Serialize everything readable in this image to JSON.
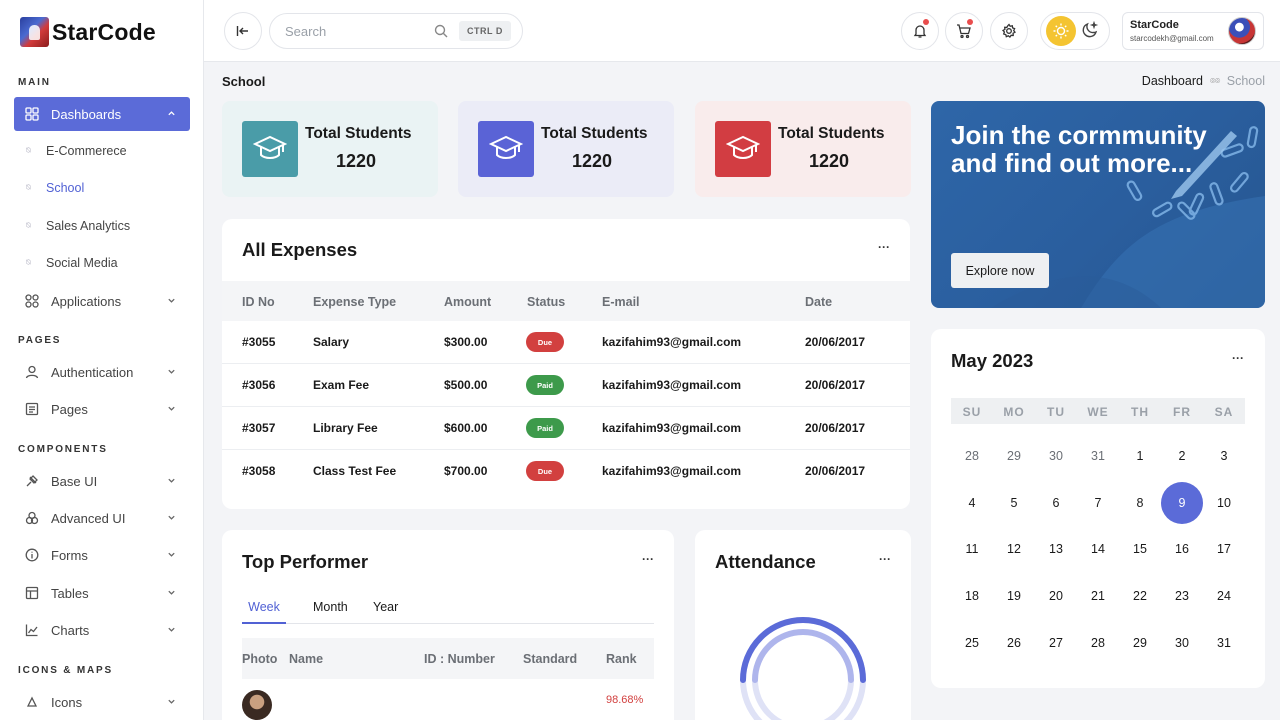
{
  "brand": {
    "name": "StarCode"
  },
  "sidebar": {
    "sections": [
      "MAIN",
      "PAGES",
      "COMPONENTS",
      "ICONS & MAPS"
    ],
    "dashboards": "Dashboards",
    "sub": [
      "E-Commerece",
      "School",
      "Sales Analytics",
      "Social Media"
    ],
    "applications": "Applications",
    "authentication": "Authentication",
    "pages": "Pages",
    "base_ui": "Base UI",
    "advanced_ui": "Advanced UI",
    "forms": "Forms",
    "tables": "Tables",
    "charts": "Charts",
    "icons": "Icons"
  },
  "topbar": {
    "search_placeholder": "Search",
    "shortcut": "CTRL D",
    "user_name": "StarCode",
    "user_email": "starcodekh@gmail.com"
  },
  "page": {
    "title": "School",
    "breadcrumb": [
      "Dashboard",
      "School"
    ]
  },
  "stats": [
    {
      "label": "Total Students",
      "value": "1220",
      "bg": "#eaf3f4",
      "icon_bg": "#4a9ca8"
    },
    {
      "label": "Total Students",
      "value": "1220",
      "bg": "#ebecf7",
      "icon_bg": "#5a63d6"
    },
    {
      "label": "Total Students",
      "value": "1220",
      "bg": "#f9ecec",
      "icon_bg": "#d23d42"
    }
  ],
  "expenses": {
    "title": "All Expenses",
    "columns": [
      "ID No",
      "Expense Type",
      "Amount",
      "Status",
      "E-mail",
      "Date"
    ],
    "rows": [
      {
        "id": "#3055",
        "type": "Salary",
        "amount": "$300.00",
        "status": "Due",
        "email": "kazifahim93@gmail.com",
        "date": "20/06/2017"
      },
      {
        "id": "#3056",
        "type": "Exam Fee",
        "amount": "$500.00",
        "status": "Paid",
        "email": "kazifahim93@gmail.com",
        "date": "20/06/2017"
      },
      {
        "id": "#3057",
        "type": "Library Fee",
        "amount": "$600.00",
        "status": "Paid",
        "email": "kazifahim93@gmail.com",
        "date": "20/06/2017"
      },
      {
        "id": "#3058",
        "type": "Class Test Fee",
        "amount": "$700.00",
        "status": "Due",
        "email": "kazifahim93@gmail.com",
        "date": "20/06/2017"
      }
    ]
  },
  "promo": {
    "title": "Join the cormmunity and find out more...",
    "button": "Explore now"
  },
  "calendar": {
    "title": "May 2023",
    "dow": [
      "SU",
      "MO",
      "TU",
      "WE",
      "TH",
      "FR",
      "SA"
    ],
    "weeks": [
      [
        "28",
        "29",
        "30",
        "31",
        "1",
        "2",
        "3"
      ],
      [
        "4",
        "5",
        "6",
        "7",
        "8",
        "9",
        "10"
      ],
      [
        "11",
        "12",
        "13",
        "14",
        "15",
        "16",
        "17"
      ],
      [
        "18",
        "19",
        "20",
        "21",
        "22",
        "23",
        "24"
      ],
      [
        "25",
        "26",
        "27",
        "28",
        "29",
        "30",
        "31"
      ]
    ],
    "selected": "9"
  },
  "performer": {
    "title": "Top Performer",
    "tabs": [
      "Week",
      "Month",
      "Year"
    ],
    "active_tab": "Week",
    "columns": [
      "Photo",
      "Name",
      "ID : Number",
      "Standard",
      "Rank"
    ],
    "first_rank": "98.68%"
  },
  "attendance": {
    "title": "Attendance"
  }
}
